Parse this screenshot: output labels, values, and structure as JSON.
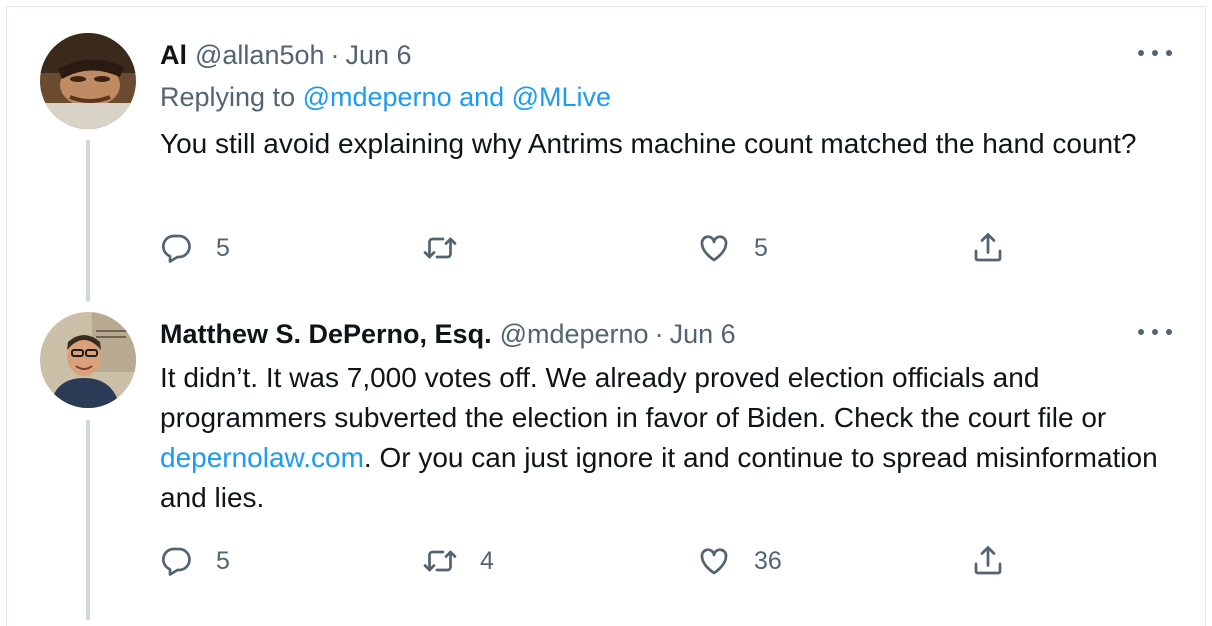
{
  "tweets": [
    {
      "display_name": "Al",
      "handle": "@allan5oh",
      "separator": "·",
      "date": "Jun 6",
      "replying_prefix": "Replying to ",
      "replying_to": "@mdeperno and @MLive",
      "text": "You still avoid explaining why Antrims machine count matched the hand count?",
      "actions": {
        "replies": "5",
        "retweets": "",
        "likes": "5"
      }
    },
    {
      "display_name": "Matthew S. DePerno, Esq.",
      "handle": "@mdeperno",
      "separator": "·",
      "date": "Jun 6",
      "text_before_link": "It didn’t. It was 7,000 votes off. We already proved election officials and programmers subverted the election in favor of Biden. Check the court file or ",
      "link": "depernolaw.com",
      "text_after_link": ". Or you can just ignore it and continue to spread misinformation and lies.",
      "actions": {
        "replies": "5",
        "retweets": "4",
        "likes": "36"
      }
    }
  ],
  "icons": [
    "reply-icon",
    "retweet-icon",
    "like-icon",
    "share-icon",
    "more-icon"
  ],
  "colors": {
    "link": "#1d9bf0",
    "secondary_text": "#536471",
    "thread_line": "#cfd9de"
  }
}
